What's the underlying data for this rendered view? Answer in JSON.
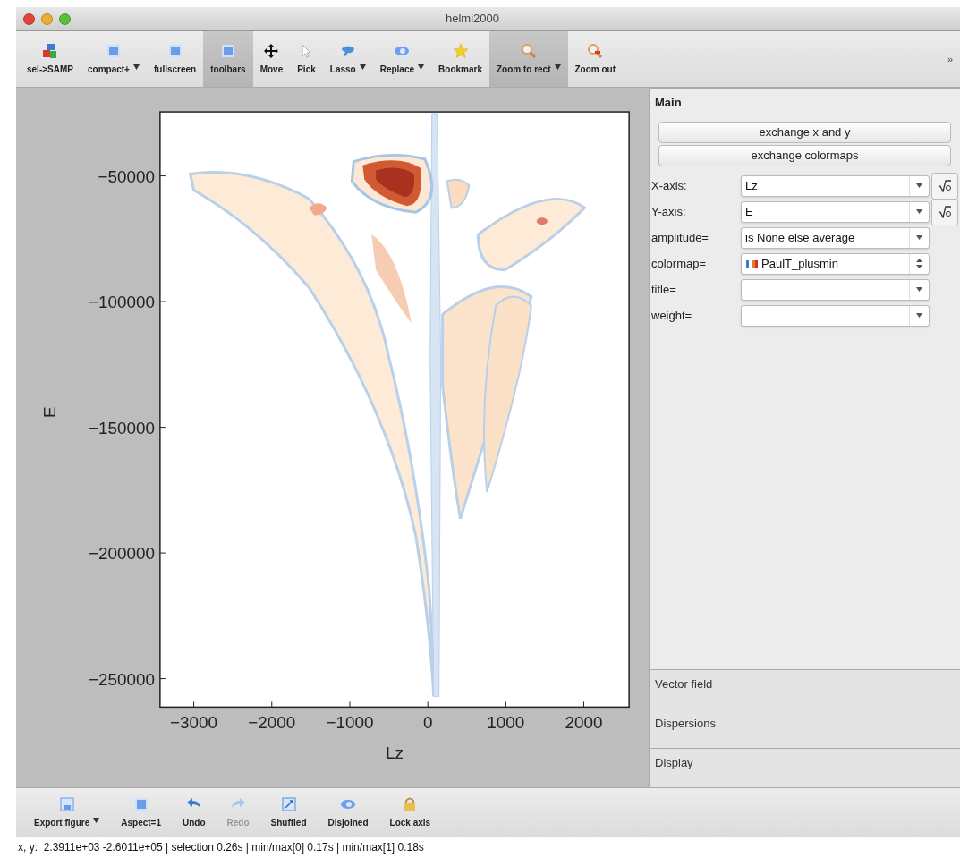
{
  "window": {
    "title": "helmi2000"
  },
  "toolbar": [
    {
      "label": "sel->SAMP",
      "kind": "samp",
      "selected": false,
      "dropdown": false
    },
    {
      "label": "compact+",
      "kind": "square",
      "selected": false,
      "dropdown": true
    },
    {
      "label": "fullscreen",
      "kind": "square",
      "selected": false,
      "dropdown": false
    },
    {
      "label": "toolbars",
      "kind": "square",
      "selected": true,
      "dropdown": false
    },
    {
      "label": "Move",
      "kind": "move",
      "selected": false,
      "dropdown": false
    },
    {
      "label": "Pick",
      "kind": "pointer",
      "selected": false,
      "dropdown": false
    },
    {
      "label": "Lasso",
      "kind": "lasso",
      "selected": false,
      "dropdown": true
    },
    {
      "label": "Replace",
      "kind": "oval",
      "selected": false,
      "dropdown": true
    },
    {
      "label": "Bookmark",
      "kind": "star",
      "selected": false,
      "dropdown": false
    },
    {
      "label": "Zoom to rect",
      "kind": "zoom",
      "selected": true,
      "dropdown": true
    },
    {
      "label": "Zoom out",
      "kind": "zoomout",
      "selected": false,
      "dropdown": false
    }
  ],
  "toolbar_overflow": "»",
  "plot": {
    "xlabel": "Lz",
    "ylabel": "E",
    "xticks": [
      "−3000",
      "−2000",
      "−1000",
      "0",
      "1000",
      "2000"
    ],
    "yticks": [
      "−50000",
      "−100000",
      "−150000",
      "−200000",
      "−250000"
    ]
  },
  "panel": {
    "tabs": [
      {
        "label": "Main",
        "selected": true
      },
      {
        "label": "Vector field",
        "selected": false
      },
      {
        "label": "Dispersions",
        "selected": false
      },
      {
        "label": "Display",
        "selected": false
      }
    ],
    "buttons": [
      "exchange x and y",
      "exchange colormaps"
    ],
    "fields": [
      {
        "label": "X-axis:",
        "kind": "combo",
        "value": "Lz",
        "transform": true
      },
      {
        "label": "Y-axis:",
        "kind": "combo",
        "value": "E",
        "transform": true
      },
      {
        "label": "amplitude=",
        "kind": "combo",
        "value": "is None else average",
        "transform": false
      },
      {
        "label": "colormap=",
        "kind": "colormap",
        "value": "PaulT_plusmin",
        "transform": false
      },
      {
        "label": "title=",
        "kind": "combo",
        "transform": false
      },
      {
        "label": "weight=",
        "kind": "combo",
        "transform": false
      }
    ]
  },
  "bottom_toolbar": [
    {
      "label": "Export figure",
      "kind": "export",
      "dropdown": true,
      "disabled": false
    },
    {
      "label": "Aspect=1",
      "kind": "square",
      "dropdown": false,
      "disabled": false
    },
    {
      "label": "Undo",
      "kind": "undo",
      "dropdown": false,
      "disabled": false
    },
    {
      "label": "Redo",
      "kind": "redo",
      "dropdown": false,
      "disabled": true
    },
    {
      "label": "Shuffled",
      "kind": "shuffle",
      "dropdown": false,
      "disabled": false
    },
    {
      "label": "Disjoined",
      "kind": "oval",
      "dropdown": false,
      "disabled": false
    },
    {
      "label": "Lock axis",
      "kind": "lock",
      "dropdown": false,
      "disabled": false
    }
  ],
  "status_bar": "x, y:  2.3911e+03 -2.6011e+05 | selection 0.26s | min/max[0] 0.17s | min/max[1] 0.18s"
}
